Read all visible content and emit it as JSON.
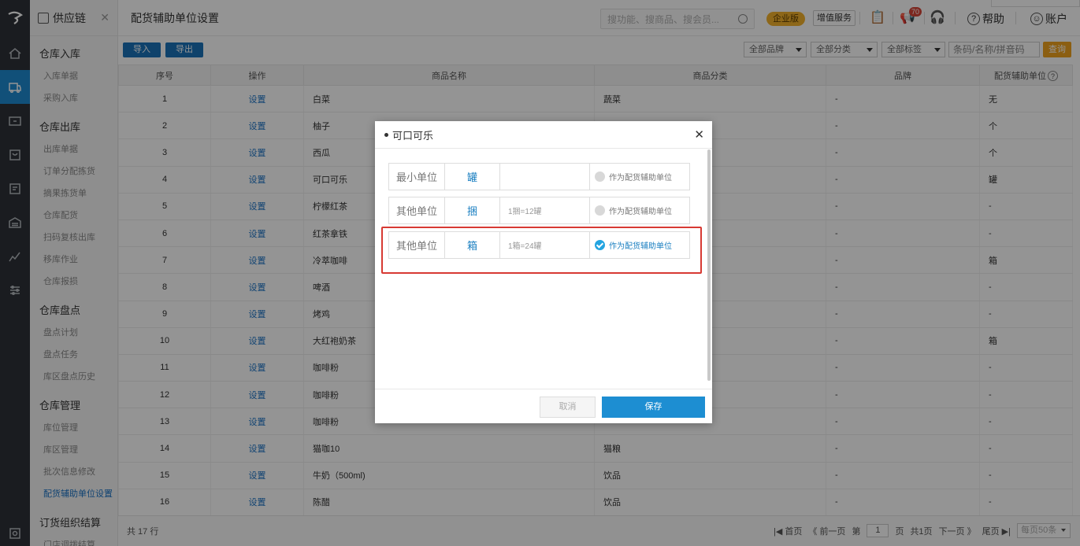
{
  "app": {
    "module_title": "供应链",
    "page_title": "配货辅助单位设置"
  },
  "header": {
    "search_placeholder": "搜功能、搜商品、搜会员...",
    "edition_badge": "企业版",
    "value_added": "增值服务",
    "notification_count": "70",
    "help": "帮助",
    "account": "账户"
  },
  "rail": {
    "items": [
      "home-icon",
      "supply-chain-icon",
      "finance-icon",
      "store-icon",
      "report-icon",
      "warehouse-icon",
      "chart-icon",
      "settings-icon"
    ],
    "bottom": "search-icon"
  },
  "sidebar": {
    "groups": [
      {
        "title": "仓库入库",
        "items": [
          "入库单据",
          "采购入库"
        ]
      },
      {
        "title": "仓库出库",
        "items": [
          "出库单据",
          "订单分配拣货",
          "摘果拣货单",
          "仓库配货",
          "扫码复核出库",
          "移库作业",
          "仓库报损"
        ]
      },
      {
        "title": "仓库盘点",
        "items": [
          "盘点计划",
          "盘点任务",
          "库区盘点历史"
        ]
      },
      {
        "title": "仓库管理",
        "items": [
          "库位管理",
          "库区管理",
          "批次信息修改",
          "配货辅助单位设置"
        ]
      },
      {
        "title": "订货组织结算",
        "items": [
          "门店调拨结算"
        ]
      }
    ]
  },
  "toolbar": {
    "import": "导入",
    "export": "导出",
    "filters": [
      "全部品牌",
      "全部分类",
      "全部标签"
    ],
    "search_placeholder": "条码/名称/拼音码",
    "query": "查询"
  },
  "table": {
    "columns": [
      "序号",
      "操作",
      "商品名称",
      "商品分类",
      "品牌",
      "配货辅助单位"
    ],
    "rows": [
      {
        "no": "1",
        "op": "设置",
        "name": "白菜",
        "category": "蔬菜",
        "brand": "-",
        "unit": "无"
      },
      {
        "no": "2",
        "op": "设置",
        "name": "柚子",
        "category": "",
        "brand": "-",
        "unit": "个"
      },
      {
        "no": "3",
        "op": "设置",
        "name": "西瓜",
        "category": "",
        "brand": "-",
        "unit": "个"
      },
      {
        "no": "4",
        "op": "设置",
        "name": "可口可乐",
        "category": "",
        "brand": "-",
        "unit": "罐"
      },
      {
        "no": "5",
        "op": "设置",
        "name": "柠檬红茶",
        "category": "",
        "brand": "-",
        "unit": "-"
      },
      {
        "no": "6",
        "op": "设置",
        "name": "红茶拿铁",
        "category": "",
        "brand": "-",
        "unit": "-"
      },
      {
        "no": "7",
        "op": "设置",
        "name": "冷萃咖啡",
        "category": "",
        "brand": "-",
        "unit": "箱"
      },
      {
        "no": "8",
        "op": "设置",
        "name": "啤酒",
        "category": "",
        "brand": "-",
        "unit": "-"
      },
      {
        "no": "9",
        "op": "设置",
        "name": "烤鸡",
        "category": "",
        "brand": "-",
        "unit": "-"
      },
      {
        "no": "10",
        "op": "设置",
        "name": "大红袍奶茶",
        "category": "",
        "brand": "-",
        "unit": "箱"
      },
      {
        "no": "11",
        "op": "设置",
        "name": "咖啡粉",
        "category": "",
        "brand": "-",
        "unit": "-"
      },
      {
        "no": "12",
        "op": "设置",
        "name": "咖啡粉",
        "category": "",
        "brand": "-",
        "unit": "-"
      },
      {
        "no": "13",
        "op": "设置",
        "name": "咖啡粉",
        "category": "",
        "brand": "-",
        "unit": "-"
      },
      {
        "no": "14",
        "op": "设置",
        "name": "猫咖10",
        "category": "猫粮",
        "brand": "-",
        "unit": "-"
      },
      {
        "no": "15",
        "op": "设置",
        "name": "牛奶（500ml)",
        "category": "饮品",
        "brand": "-",
        "unit": "-"
      },
      {
        "no": "16",
        "op": "设置",
        "name": "陈醋",
        "category": "饮品",
        "brand": "-",
        "unit": "-"
      }
    ]
  },
  "footer": {
    "total": "共 17 行",
    "first": "首页",
    "prev": "前一页",
    "page_prefix": "第",
    "page_value": "1",
    "page_suffix": "页",
    "total_pages": "共1页",
    "next": "下一页",
    "last": "尾页",
    "page_size": "每页50条"
  },
  "modal": {
    "title": "可口可乐",
    "rows": [
      {
        "label": "最小单位",
        "unit": "罐",
        "conversion": "",
        "option": "作为配货辅助单位",
        "checked": false
      },
      {
        "label": "其他单位",
        "unit": "捆",
        "conversion": "1捆=12罐",
        "option": "作为配货辅助单位",
        "checked": false
      },
      {
        "label": "其他单位",
        "unit": "箱",
        "conversion": "1箱=24罐",
        "option": "作为配货辅助单位",
        "checked": true
      }
    ],
    "cancel": "取消",
    "save": "保存"
  }
}
